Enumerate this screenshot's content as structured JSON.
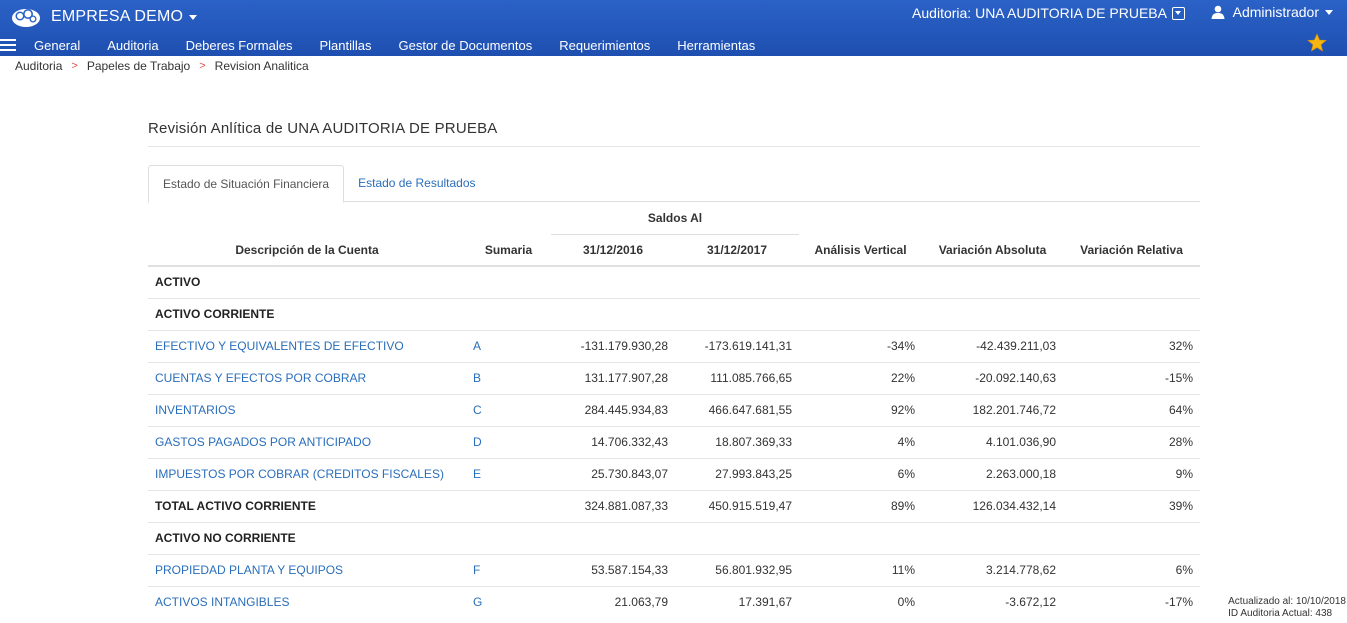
{
  "header": {
    "company": "EMPRESA DEMO",
    "audit_label": "Auditoria: UNA AUDITORIA DE PRUEBA",
    "user": "Administrador",
    "accent": "#2b62c7",
    "star_color": "#f5b512"
  },
  "nav": {
    "items": [
      "General",
      "Auditoria",
      "Deberes Formales",
      "Plantillas",
      "Gestor de Documentos",
      "Requerimientos",
      "Herramientas"
    ]
  },
  "breadcrumb": [
    "Auditoria",
    "Papeles de Trabajo",
    "Revision Analitica"
  ],
  "page": {
    "title": "Revisión Anlítica de UNA AUDITORIA DE PRUEBA",
    "tabs": [
      "Estado de Situación Financiera",
      "Estado de Resultados"
    ]
  },
  "table": {
    "group_header": "Saldos Al",
    "columns": [
      "Descripción de la Cuenta",
      "Sumaria",
      "31/12/2016",
      "31/12/2017",
      "Análisis Vertical",
      "Variación Absoluta",
      "Variación Relativa"
    ],
    "rows": [
      {
        "type": "section",
        "label": "ACTIVO"
      },
      {
        "type": "section",
        "label": "ACTIVO CORRIENTE"
      },
      {
        "type": "account",
        "label": "EFECTIVO Y EQUIVALENTES DE EFECTIVO",
        "sumaria": "A",
        "v2016": "-131.179.930,28",
        "v2017": "-173.619.141,31",
        "vertical": "-34%",
        "abs": "-42.439.211,03",
        "rel": "32%"
      },
      {
        "type": "account",
        "label": "CUENTAS Y EFECTOS POR COBRAR",
        "sumaria": "B",
        "v2016": "131.177.907,28",
        "v2017": "111.085.766,65",
        "vertical": "22%",
        "abs": "-20.092.140,63",
        "rel": "-15%"
      },
      {
        "type": "account",
        "label": "INVENTARIOS",
        "sumaria": "C",
        "v2016": "284.445.934,83",
        "v2017": "466.647.681,55",
        "vertical": "92%",
        "abs": "182.201.746,72",
        "rel": "64%"
      },
      {
        "type": "account",
        "label": "GASTOS PAGADOS POR ANTICIPADO",
        "sumaria": "D",
        "v2016": "14.706.332,43",
        "v2017": "18.807.369,33",
        "vertical": "4%",
        "abs": "4.101.036,90",
        "rel": "28%"
      },
      {
        "type": "account",
        "label": "IMPUESTOS POR COBRAR (CREDITOS FISCALES)",
        "sumaria": "E",
        "v2016": "25.730.843,07",
        "v2017": "27.993.843,25",
        "vertical": "6%",
        "abs": "2.263.000,18",
        "rel": "9%"
      },
      {
        "type": "total",
        "label": "TOTAL ACTIVO CORRIENTE",
        "sumaria": "",
        "v2016": "324.881.087,33",
        "v2017": "450.915.519,47",
        "vertical": "89%",
        "abs": "126.034.432,14",
        "rel": "39%"
      },
      {
        "type": "section",
        "label": "ACTIVO NO CORRIENTE"
      },
      {
        "type": "account",
        "label": "PROPIEDAD PLANTA Y EQUIPOS",
        "sumaria": "F",
        "v2016": "53.587.154,33",
        "v2017": "56.801.932,95",
        "vertical": "11%",
        "abs": "3.214.778,62",
        "rel": "6%"
      },
      {
        "type": "account",
        "label": "ACTIVOS INTANGIBLES",
        "sumaria": "G",
        "v2016": "21.063,79",
        "v2017": "17.391,67",
        "vertical": "0%",
        "abs": "-3.672,12",
        "rel": "-17%"
      }
    ]
  },
  "footer": {
    "updated": "Actualizado al: 10/10/2018",
    "audit_id": "ID Auditoria Actual: 438"
  }
}
